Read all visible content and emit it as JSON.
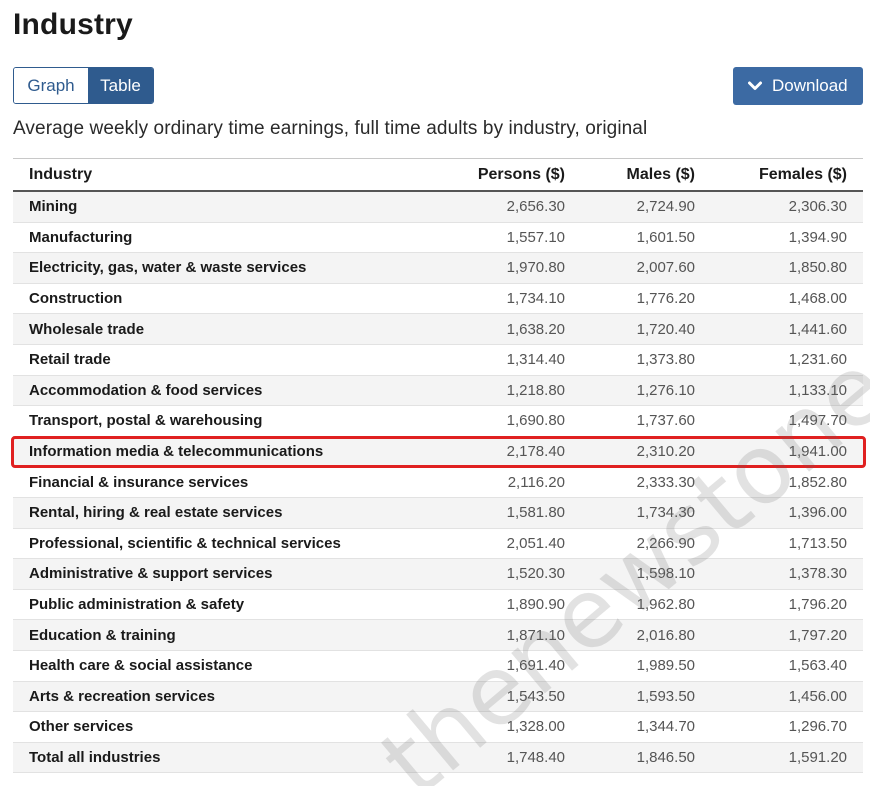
{
  "page": {
    "title": "Industry",
    "subtitle": "Average weekly ordinary time earnings, full time adults by industry, original"
  },
  "toggle": {
    "graph_label": "Graph",
    "table_label": "Table",
    "selected": "Table"
  },
  "download": {
    "label": "Download",
    "icon": "chevron-down-icon"
  },
  "table": {
    "headers": [
      "Industry",
      "Persons ($)",
      "Males ($)",
      "Females ($)"
    ],
    "rows": [
      [
        "Mining",
        "2,656.30",
        "2,724.90",
        "2,306.30"
      ],
      [
        "Manufacturing",
        "1,557.10",
        "1,601.50",
        "1,394.90"
      ],
      [
        "Electricity, gas, water & waste services",
        "1,970.80",
        "2,007.60",
        "1,850.80"
      ],
      [
        "Construction",
        "1,734.10",
        "1,776.20",
        "1,468.00"
      ],
      [
        "Wholesale trade",
        "1,638.20",
        "1,720.40",
        "1,441.60"
      ],
      [
        "Retail trade",
        "1,314.40",
        "1,373.80",
        "1,231.60"
      ],
      [
        "Accommodation & food services",
        "1,218.80",
        "1,276.10",
        "1,133.10"
      ],
      [
        "Transport, postal & warehousing",
        "1,690.80",
        "1,737.60",
        "1,497.70"
      ],
      [
        "Information media & telecommunications",
        "2,178.40",
        "2,310.20",
        "1,941.00"
      ],
      [
        "Financial & insurance services",
        "2,116.20",
        "2,333.30",
        "1,852.80"
      ],
      [
        "Rental, hiring & real estate services",
        "1,581.80",
        "1,734.30",
        "1,396.00"
      ],
      [
        "Professional, scientific & technical services",
        "2,051.40",
        "2,266.90",
        "1,713.50"
      ],
      [
        "Administrative & support services",
        "1,520.30",
        "1,598.10",
        "1,378.30"
      ],
      [
        "Public administration & safety",
        "1,890.90",
        "1,962.80",
        "1,796.20"
      ],
      [
        "Education & training",
        "1,871.10",
        "2,016.80",
        "1,797.20"
      ],
      [
        "Health care & social assistance",
        "1,691.40",
        "1,989.50",
        "1,563.40"
      ],
      [
        "Arts & recreation services",
        "1,543.50",
        "1,593.50",
        "1,456.00"
      ],
      [
        "Other services",
        "1,328.00",
        "1,344.70",
        "1,296.70"
      ],
      [
        "Total all industries",
        "1,748.40",
        "1,846.50",
        "1,591.20"
      ]
    ],
    "highlighted_row_index": 8
  },
  "watermark": {
    "text": "thenewstone.com"
  },
  "colors": {
    "accent": "#2f5b8e",
    "download_bg": "#3c6aa3",
    "highlight": "#e02020"
  }
}
